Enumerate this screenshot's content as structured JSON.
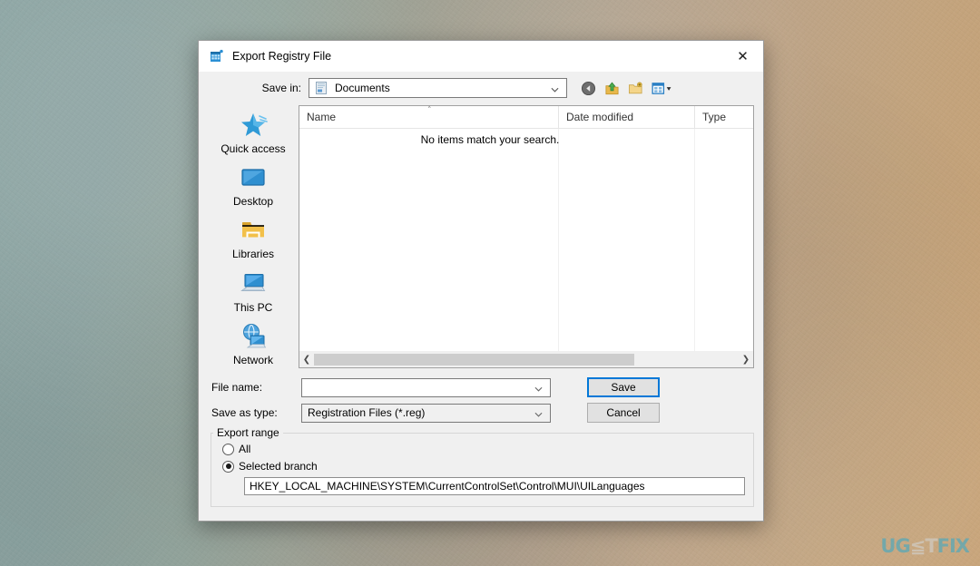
{
  "window": {
    "title": "Export Registry File",
    "icon": "registry-editor-icon",
    "close_label": "✕"
  },
  "savein": {
    "label": "Save in:",
    "value": "Documents",
    "icon": "documents-folder-icon",
    "caret": "chevron-down-icon"
  },
  "toolbar": {
    "buttons": [
      {
        "name": "back-button",
        "icon": "back-arrow-icon"
      },
      {
        "name": "up-one-level-button",
        "icon": "up-folder-icon"
      },
      {
        "name": "new-folder-button",
        "icon": "new-folder-icon"
      },
      {
        "name": "view-menu-button",
        "icon": "views-icon"
      }
    ]
  },
  "places": [
    {
      "label": "Quick access",
      "icon": "star-icon"
    },
    {
      "label": "Desktop",
      "icon": "monitor-icon"
    },
    {
      "label": "Libraries",
      "icon": "folder-icon"
    },
    {
      "label": "This PC",
      "icon": "computer-icon"
    },
    {
      "label": "Network",
      "icon": "network-globe-icon"
    }
  ],
  "filelist": {
    "columns": [
      "Name",
      "Date modified",
      "Type"
    ],
    "sort_indicator": "˄",
    "rows": [],
    "empty_message": "No items match your search."
  },
  "fields": {
    "filename_label": "File name:",
    "filename_value": "",
    "filetype_label": "Save as type:",
    "filetype_value": "Registration Files (*.reg)"
  },
  "buttons": {
    "save": "Save",
    "cancel": "Cancel"
  },
  "export_range": {
    "legend": "Export range",
    "options": [
      {
        "label": "All",
        "selected": false
      },
      {
        "label": "Selected branch",
        "selected": true
      }
    ],
    "branch_path": "HKEY_LOCAL_MACHINE\\SYSTEM\\CurrentControlSet\\Control\\MUI\\UILanguages"
  },
  "watermark": {
    "part1": "UG",
    "part2": "≦T",
    "part3": "FIX",
    "full": "UGETFIX"
  },
  "colors": {
    "accent": "#0078d7",
    "dialog_bg": "#f0f0f0",
    "titlebar_bg": "#ffffff"
  }
}
